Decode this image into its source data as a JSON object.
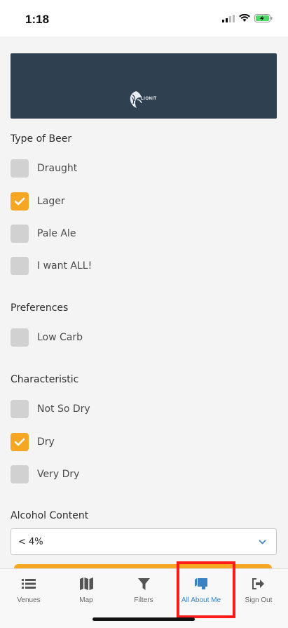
{
  "status": {
    "time": "1:18"
  },
  "banner": {
    "logo_text": "LIONIT"
  },
  "sections": {
    "type_of_beer": {
      "title": "Type of Beer",
      "options": [
        {
          "label": "Draught",
          "checked": false
        },
        {
          "label": "Lager",
          "checked": true
        },
        {
          "label": "Pale Ale",
          "checked": false
        },
        {
          "label": "I want ALL!",
          "checked": false
        }
      ]
    },
    "preferences": {
      "title": "Preferences",
      "options": [
        {
          "label": "Low Carb",
          "checked": false
        }
      ]
    },
    "characteristic": {
      "title": "Characteristic",
      "options": [
        {
          "label": "Not So Dry",
          "checked": false
        },
        {
          "label": "Dry",
          "checked": true
        },
        {
          "label": "Very Dry",
          "checked": false
        }
      ]
    },
    "alcohol": {
      "title": "Alcohol Content",
      "selected": "< 4%"
    }
  },
  "tabs": [
    {
      "label": "Venues",
      "icon": "list-icon",
      "active": false
    },
    {
      "label": "Map",
      "icon": "map-icon",
      "active": false
    },
    {
      "label": "Filters",
      "icon": "filter-icon",
      "active": false
    },
    {
      "label": "All About Me",
      "icon": "profile-icon",
      "active": true
    },
    {
      "label": "Sign Out",
      "icon": "sign-out-icon",
      "active": false
    }
  ],
  "colors": {
    "accent": "#f5a623",
    "banner": "#2f4050",
    "active_tab": "#3b82c4",
    "highlight": "#ff1a1a"
  }
}
